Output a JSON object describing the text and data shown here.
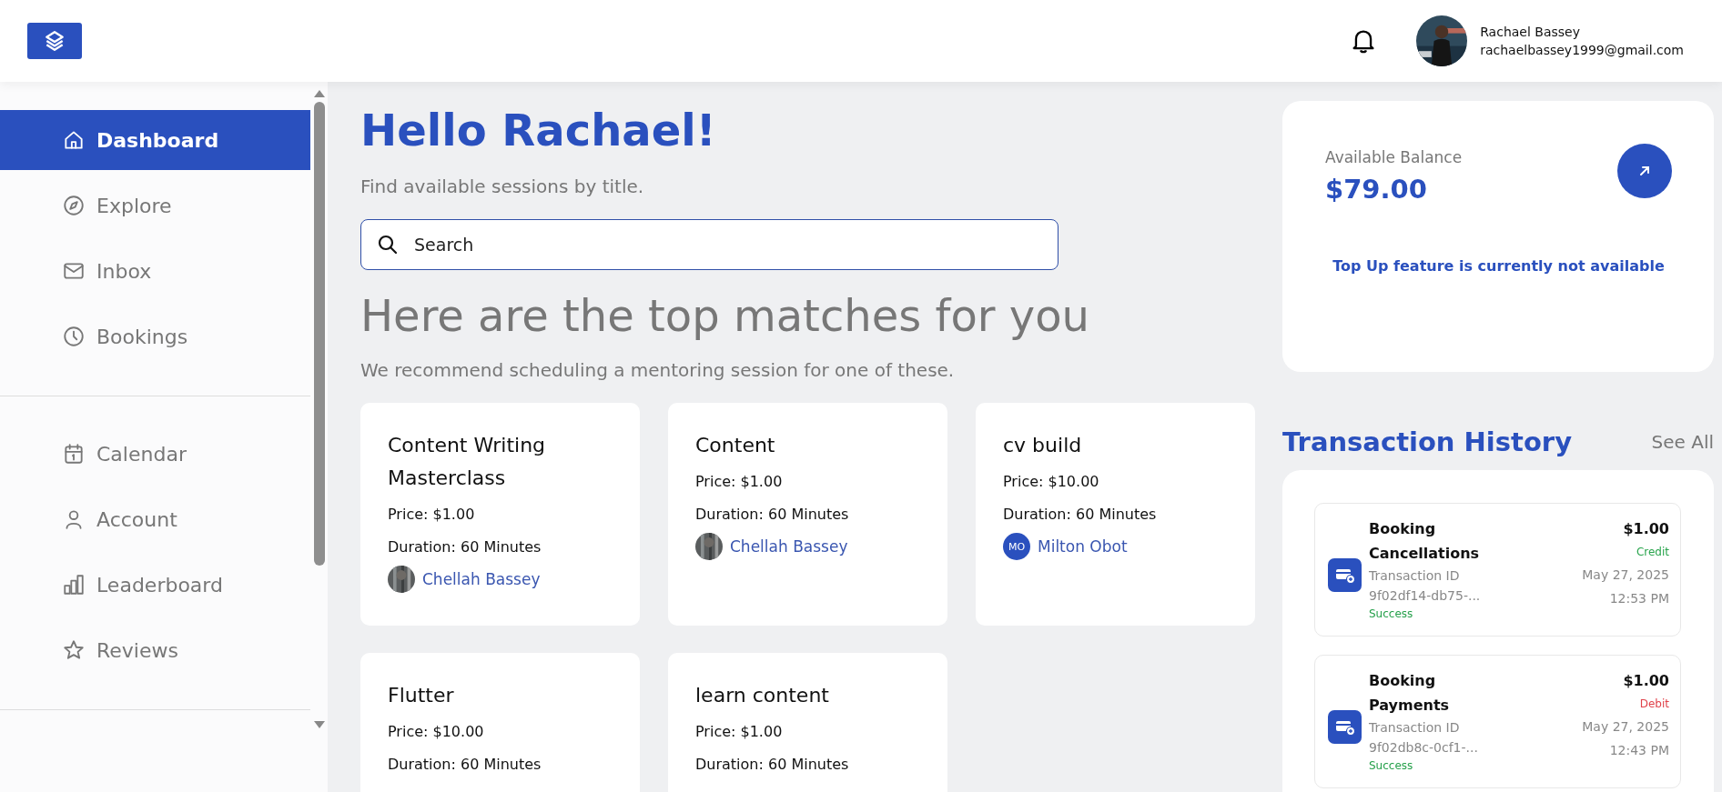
{
  "header": {
    "user": {
      "name": "Rachael Bassey",
      "email": "rachaelbassey1999@gmail.com"
    }
  },
  "sidebar": {
    "groups": [
      {
        "items": [
          {
            "label": "Dashboard",
            "selected": true
          },
          {
            "label": "Explore",
            "selected": false
          },
          {
            "label": "Inbox",
            "selected": false
          },
          {
            "label": "Bookings",
            "selected": false
          }
        ]
      },
      {
        "items": [
          {
            "label": "Calendar",
            "selected": false
          },
          {
            "label": "Account",
            "selected": false
          },
          {
            "label": "Leaderboard",
            "selected": false
          },
          {
            "label": "Reviews",
            "selected": false
          }
        ]
      }
    ]
  },
  "main": {
    "greeting": "Hello Rachael!",
    "subtitle": "Find available sessions by title.",
    "search": {
      "placeholder": "Search"
    },
    "heading": "Here are the top matches for you",
    "description": "We recommend scheduling a mentoring session for one of these.",
    "sessions": [
      {
        "title": "Content Writing Masterclass",
        "price": "Price: $1.00",
        "duration": "Duration: 60 Minutes",
        "mentor": {
          "name": "Chellah Bassey"
        }
      },
      {
        "title": "Content",
        "price": "Price: $1.00",
        "duration": "Duration: 60 Minutes",
        "mentor": {
          "name": "Chellah Bassey"
        }
      },
      {
        "title": "cv build",
        "price": "Price: $10.00",
        "duration": "Duration: 60 Minutes",
        "mentor": {
          "name": "Milton Obot",
          "avatar": {
            "kind": "initials",
            "text": "MO"
          }
        }
      },
      {
        "title": "Flutter",
        "price": "Price: $10.00",
        "duration": "Duration: 60 Minutes"
      },
      {
        "title": "learn content",
        "price": "Price: $1.00",
        "duration": "Duration: 60 Minutes"
      }
    ]
  },
  "balance": {
    "label": "Available Balance",
    "amount": "$79.00",
    "notice": "Top Up feature is currently not available"
  },
  "transactions": {
    "title": "Transaction History",
    "see_all": "See All",
    "items": [
      {
        "title": "Booking Cancellations",
        "id_label": "Transaction ID",
        "id": "9f02df14-db75-...",
        "status": "Success",
        "amount": "$1.00",
        "kind": "credit",
        "type": "Credit",
        "date": "May 27, 2025",
        "time": "12:53 PM"
      },
      {
        "title": "Booking Payments",
        "id_label": "Transaction ID",
        "id": "9f02db8c-0cf1-...",
        "status": "Success",
        "amount": "$1.00",
        "kind": "debit",
        "type": "Debit",
        "date": "May 27, 2025",
        "time": "12:43 PM"
      }
    ]
  }
}
